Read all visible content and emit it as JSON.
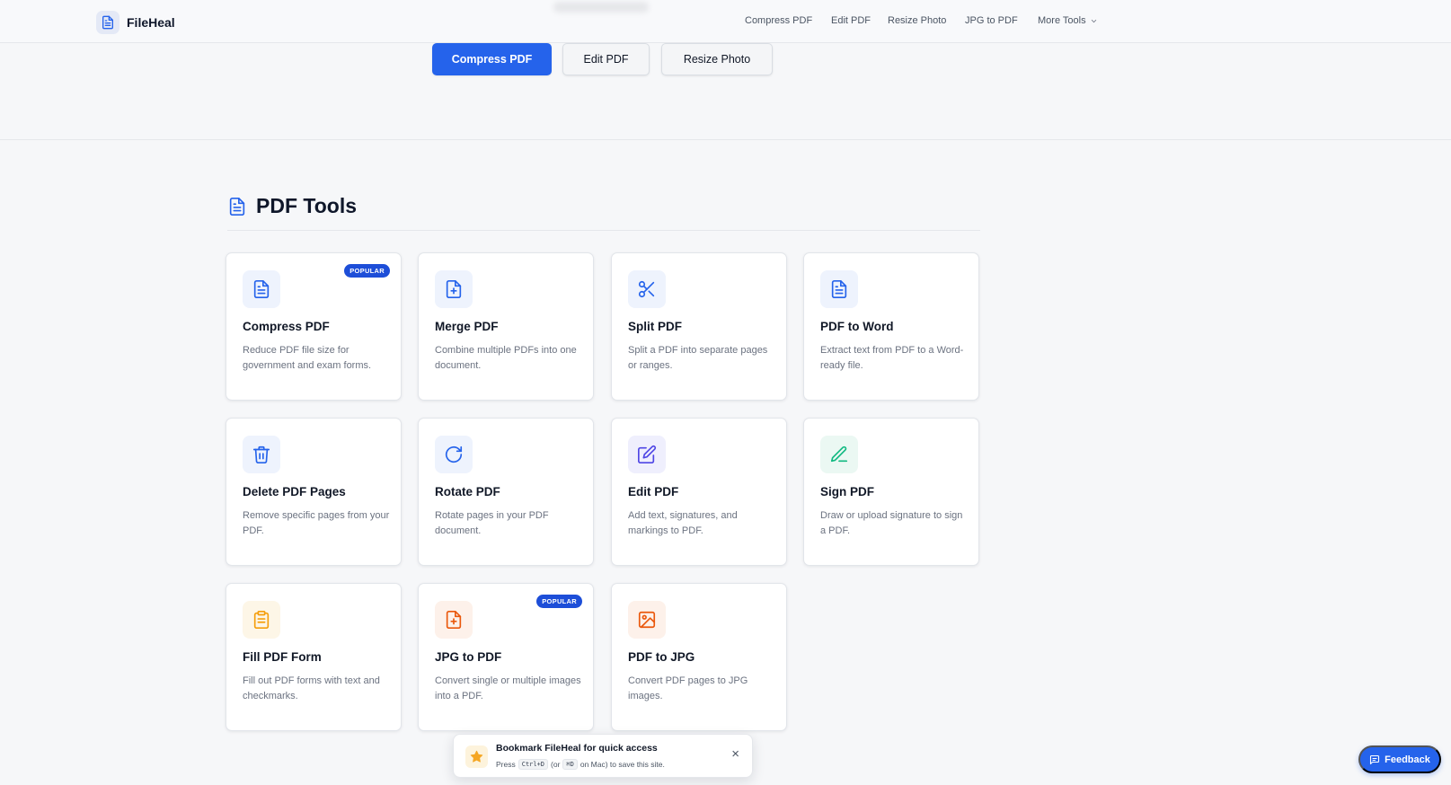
{
  "header": {
    "logo_text": "FileHeal",
    "nav": [
      "Compress PDF",
      "Edit PDF",
      "Resize Photo",
      "JPG to PDF"
    ],
    "more_label": "More Tools"
  },
  "hero": {
    "buttons": [
      "Compress PDF",
      "Edit PDF",
      "Resize Photo"
    ]
  },
  "section": {
    "title": "PDF Tools"
  },
  "tools": [
    {
      "title": "Compress PDF",
      "desc": "Reduce PDF file size for government and exam forms.",
      "badge": "POPULAR",
      "icon": "file-text-icon",
      "color": "#2563eb"
    },
    {
      "title": "Merge PDF",
      "desc": "Combine multiple PDFs into one document.",
      "icon": "file-plus-icon",
      "color": "#2563eb"
    },
    {
      "title": "Split PDF",
      "desc": "Split a PDF into separate pages or ranges.",
      "icon": "scissors-icon",
      "color": "#2563eb"
    },
    {
      "title": "PDF to Word",
      "desc": "Extract text from PDF to a Word-ready file.",
      "icon": "file-text-icon",
      "color": "#2563eb"
    },
    {
      "title": "Delete PDF Pages",
      "desc": "Remove specific pages from your PDF.",
      "icon": "trash-icon",
      "color": "#2563eb"
    },
    {
      "title": "Rotate PDF",
      "desc": "Rotate pages in your PDF document.",
      "icon": "rotate-icon",
      "color": "#2563eb"
    },
    {
      "title": "Edit PDF",
      "desc": "Add text, signatures, and markings to PDF.",
      "icon": "edit-icon",
      "color": "#4f46e5"
    },
    {
      "title": "Sign PDF",
      "desc": "Draw or upload signature to sign a PDF.",
      "icon": "pen-icon",
      "color": "#10b981"
    },
    {
      "title": "Fill PDF Form",
      "desc": "Fill out PDF forms with text and checkmarks.",
      "icon": "clipboard-icon",
      "color": "#f59e0b"
    },
    {
      "title": "JPG to PDF",
      "desc": "Convert single or multiple images into a PDF.",
      "badge": "POPULAR",
      "icon": "file-plus-icon",
      "color": "#ea580c"
    },
    {
      "title": "PDF to JPG",
      "desc": "Convert PDF pages to JPG images.",
      "icon": "image-icon",
      "color": "#ea580c"
    }
  ],
  "toast": {
    "title": "Bookmark FileHeal for quick access",
    "press": "Press",
    "key1": "Ctrl+D",
    "or": "(or",
    "key2": "⌘D",
    "rest": "on Mac) to save this site.",
    "close": "×"
  },
  "feedback": {
    "label": "Feedback"
  }
}
